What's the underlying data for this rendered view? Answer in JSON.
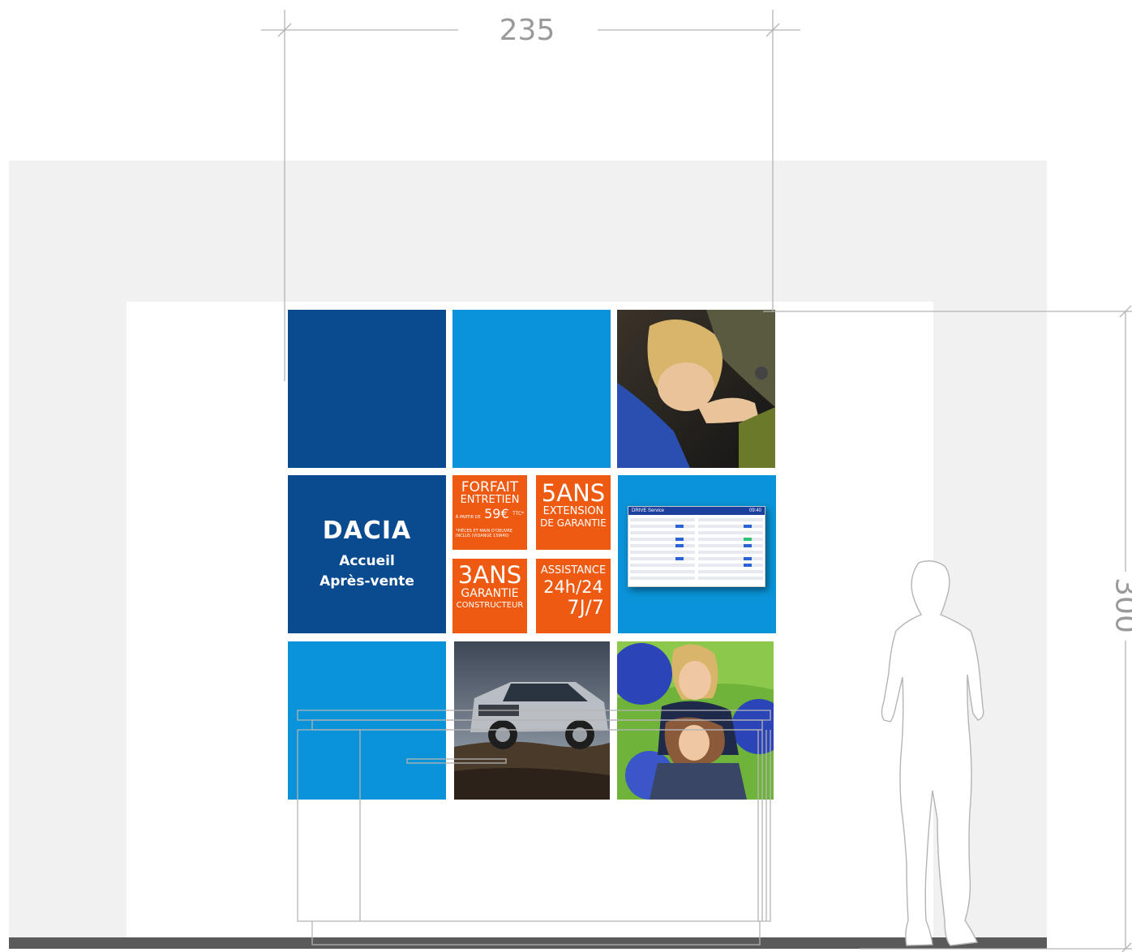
{
  "dimensions": {
    "width": "235",
    "height": "300"
  },
  "brand": {
    "logo": "DACIA",
    "line1": "Accueil",
    "line2": "Après-vente"
  },
  "promos": {
    "forfait": {
      "l1": "FORFAIT",
      "l2": "ENTRETIEN",
      "prefix": "À PARTIR DE",
      "price": "59€",
      "suffix": "TTC*",
      "note": "*PIÈCES ET MAIN D'OEUVRE INCLUS (VIDANGE 15W40)"
    },
    "five": {
      "l1": "5ANS",
      "l2": "EXTENSION",
      "l3": "DE GARANTIE"
    },
    "three": {
      "l1": "3ANS",
      "l2": "GARANTIE",
      "l3": "CONSTRUCTEUR"
    },
    "assist": {
      "l1": "ASSISTANCE",
      "l2": "24h/24",
      "l3": "7J/7"
    }
  },
  "screen": {
    "title": "DRIVE Service",
    "time": "09:40"
  },
  "colors": {
    "dark_blue": "#0a4a8f",
    "light_blue": "#0a93d8",
    "orange": "#ee5a11",
    "wall": "#f1f1f1",
    "floor": "#5a5a5a"
  },
  "images": [
    "woman-with-car-key-photo",
    "dacia-duster-photo",
    "laughing-women-balloons-photo"
  ]
}
